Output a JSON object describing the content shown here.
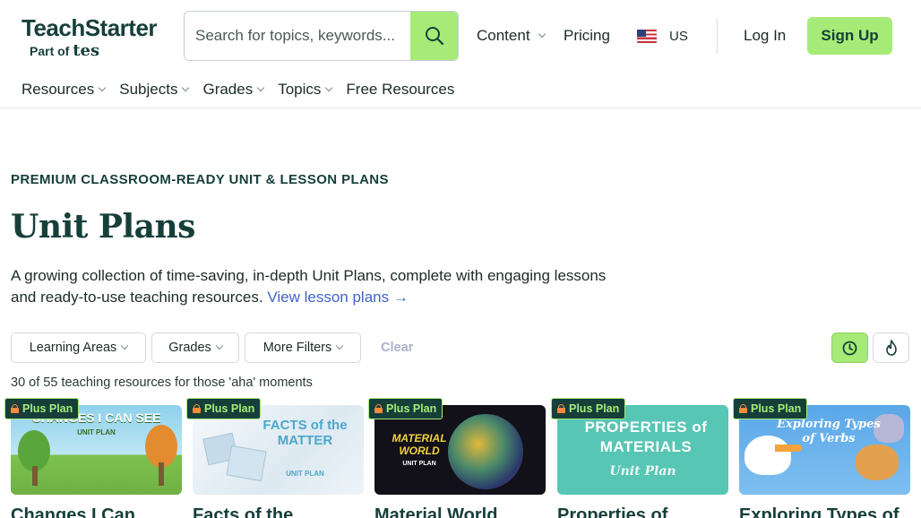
{
  "brand": {
    "name": "TeachStarter",
    "sub_prefix": "Part of",
    "sub_brand": "tes"
  },
  "search": {
    "placeholder": "Search for topics, keywords..."
  },
  "header_nav": {
    "content": "Content",
    "pricing": "Pricing",
    "region": "US",
    "login": "Log In",
    "signup": "Sign Up"
  },
  "subnav": [
    {
      "label": "Resources",
      "dropdown": true
    },
    {
      "label": "Subjects",
      "dropdown": true
    },
    {
      "label": "Grades",
      "dropdown": true
    },
    {
      "label": "Topics",
      "dropdown": true
    },
    {
      "label": "Free Resources",
      "dropdown": false
    }
  ],
  "hero": {
    "eyebrow": "PREMIUM CLASSROOM-READY UNIT & LESSON PLANS",
    "title": "Unit Plans",
    "lead": "A growing collection of time-saving, in-depth Unit Plans, complete with engaging lessons and ready-to-use teaching resources.",
    "link": "View lesson plans →"
  },
  "filters": {
    "learning_areas": "Learning Areas",
    "grades": "Grades",
    "more": "More Filters",
    "clear": "Clear"
  },
  "sort": {
    "recent_icon": "clock-icon",
    "popular_icon": "flame-icon"
  },
  "result_count": "30 of 55 teaching resources for those 'aha' moments",
  "cards": [
    {
      "badge": "Plus Plan",
      "thumb_line1": "CHANGES I CAN SEE",
      "thumb_line2": "UNIT PLAN",
      "title": "Changes I Can",
      "bg": "#8fd1ec"
    },
    {
      "badge": "Plus Plan",
      "thumb_line1": "FACTS of the MATTER",
      "thumb_line2": "UNIT PLAN",
      "title": "Facts of the",
      "bg": "#e8f1f6"
    },
    {
      "badge": "Plus Plan",
      "thumb_line1": "MATERIAL WORLD",
      "thumb_line2": "UNIT PLAN",
      "title": "Material World",
      "bg": "#121018"
    },
    {
      "badge": "Plus Plan",
      "thumb_line1": "PROPERTIES of MATERIALS",
      "thumb_line2": "Unit Plan",
      "title": "Properties of",
      "bg": "#57c6b4"
    },
    {
      "badge": "Plus Plan",
      "thumb_line1": "Exploring Types of Verbs",
      "thumb_line2": "",
      "title": "Exploring Types of",
      "bg": "#5aa7e8"
    }
  ],
  "colors": {
    "brand": "#163f3a",
    "accent": "#a6eb77",
    "link": "#4062c9"
  }
}
